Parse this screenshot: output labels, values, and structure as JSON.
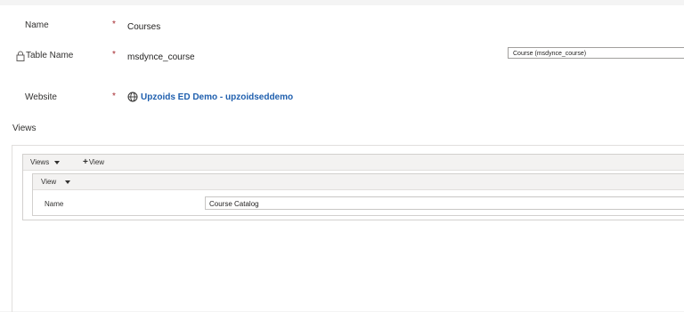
{
  "form": {
    "name": {
      "label": "Name",
      "required_mark": "*",
      "value": "Courses"
    },
    "table_name": {
      "label": "Table Name",
      "required_mark": "*",
      "value": "msdynce_course",
      "lookup_value": "Course (msdynce_course)"
    },
    "website": {
      "label": "Website",
      "required_mark": "*",
      "value": "Upzoids ED Demo - upzoidseddemo"
    }
  },
  "views_section": {
    "label": "Views",
    "toolbar": {
      "views_label": "Views",
      "add_label": "View"
    },
    "view": {
      "toolbar_label": "View",
      "name_label": "Name",
      "name_value": "Course Catalog"
    }
  },
  "colors": {
    "required": "#a4262c",
    "link": "#1f5fae",
    "toolbar_bg": "#f3f2f1"
  },
  "icons": [
    "lock-icon",
    "globe-icon",
    "chevron-down-icon",
    "plus-icon"
  ]
}
